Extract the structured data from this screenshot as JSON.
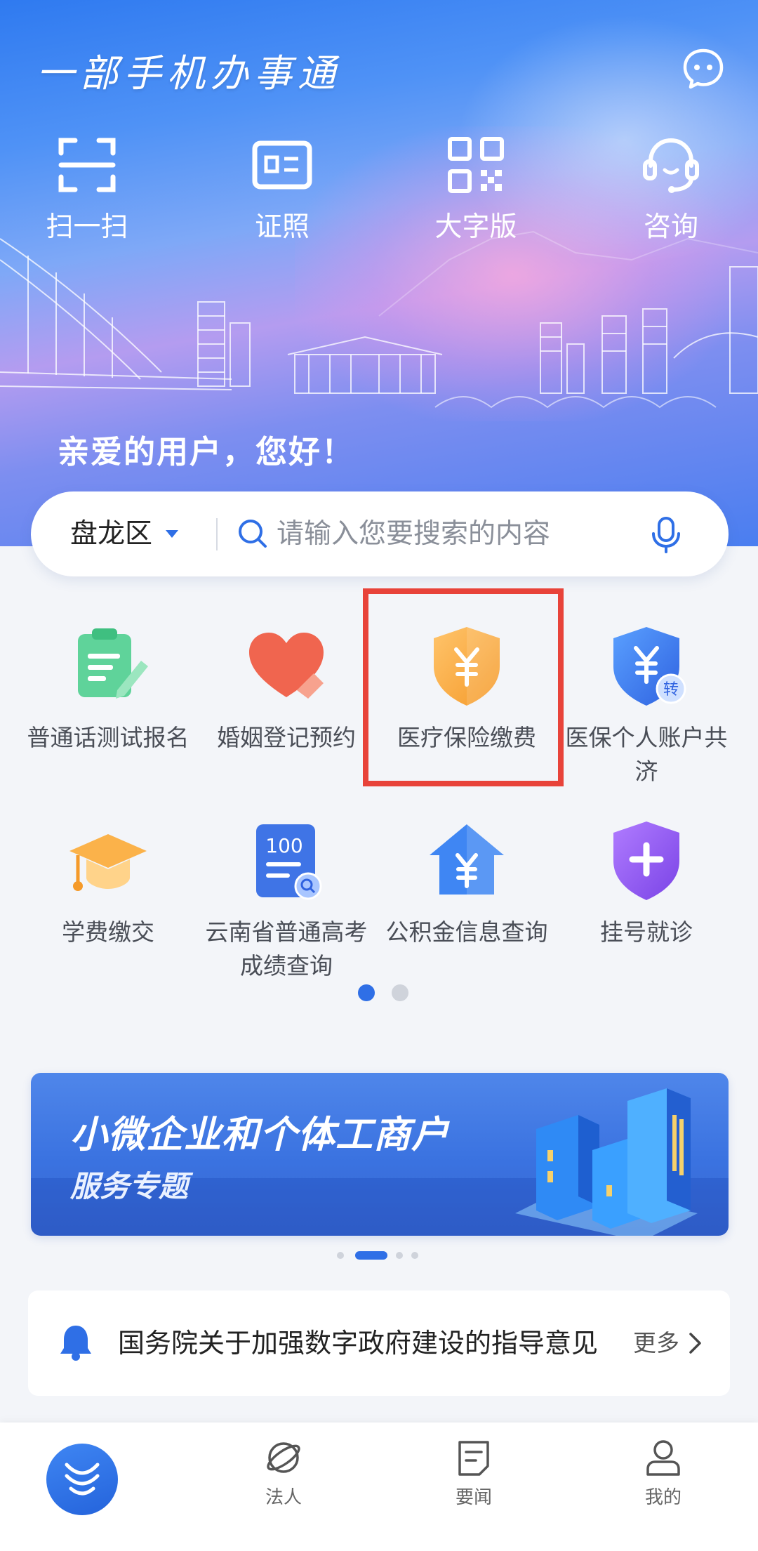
{
  "header": {
    "title": "一部手机办事通",
    "greeting": "亲爱的用户，您好！",
    "quick_actions": [
      {
        "label": "扫一扫",
        "icon": "scan-icon"
      },
      {
        "label": "证照",
        "icon": "id-card-icon"
      },
      {
        "label": "大字版",
        "icon": "qr-grid-icon"
      },
      {
        "label": "咨询",
        "icon": "headset-icon"
      }
    ],
    "message_icon": "chat-bubble-icon"
  },
  "search": {
    "district": "盘龙区",
    "placeholder": "请输入您要搜索的内容"
  },
  "services": [
    {
      "label": "普通话测试报名",
      "icon": "form-pencil-icon"
    },
    {
      "label": "婚姻登记预约",
      "icon": "heart-icon"
    },
    {
      "label": "医疗保险缴费",
      "icon": "shield-yuan-icon",
      "highlighted": true
    },
    {
      "label": "医保个人账户共济",
      "icon": "shield-yuan-transfer-icon"
    },
    {
      "label": "学费缴交",
      "icon": "graduation-cap-icon"
    },
    {
      "label": "云南省普通高考成绩查询",
      "icon": "score-clipboard-icon"
    },
    {
      "label": "公积金信息查询",
      "icon": "house-yuan-icon"
    },
    {
      "label": "挂号就诊",
      "icon": "shield-plus-icon"
    }
  ],
  "service_pages": {
    "current": 1,
    "total": 2
  },
  "banner": {
    "title": "小微企业和个体工商户",
    "subtitle": "服务专题",
    "pages": {
      "current": 2,
      "total": 4
    }
  },
  "notice": {
    "text": "国务院关于加强数字政府建设的指导意见",
    "more": "更多"
  },
  "tabbar": {
    "items": [
      {
        "label": "",
        "icon": "home-logo-icon",
        "active": true
      },
      {
        "label": "法人",
        "icon": "orbit-icon"
      },
      {
        "label": "要闻",
        "icon": "news-icon"
      },
      {
        "label": "我的",
        "icon": "user-icon"
      }
    ]
  },
  "colors": {
    "primary": "#2f6fe6",
    "highlight_border": "#e8433a",
    "hero_top": "#2f7af0",
    "hero_pink": "#e6a0de"
  }
}
